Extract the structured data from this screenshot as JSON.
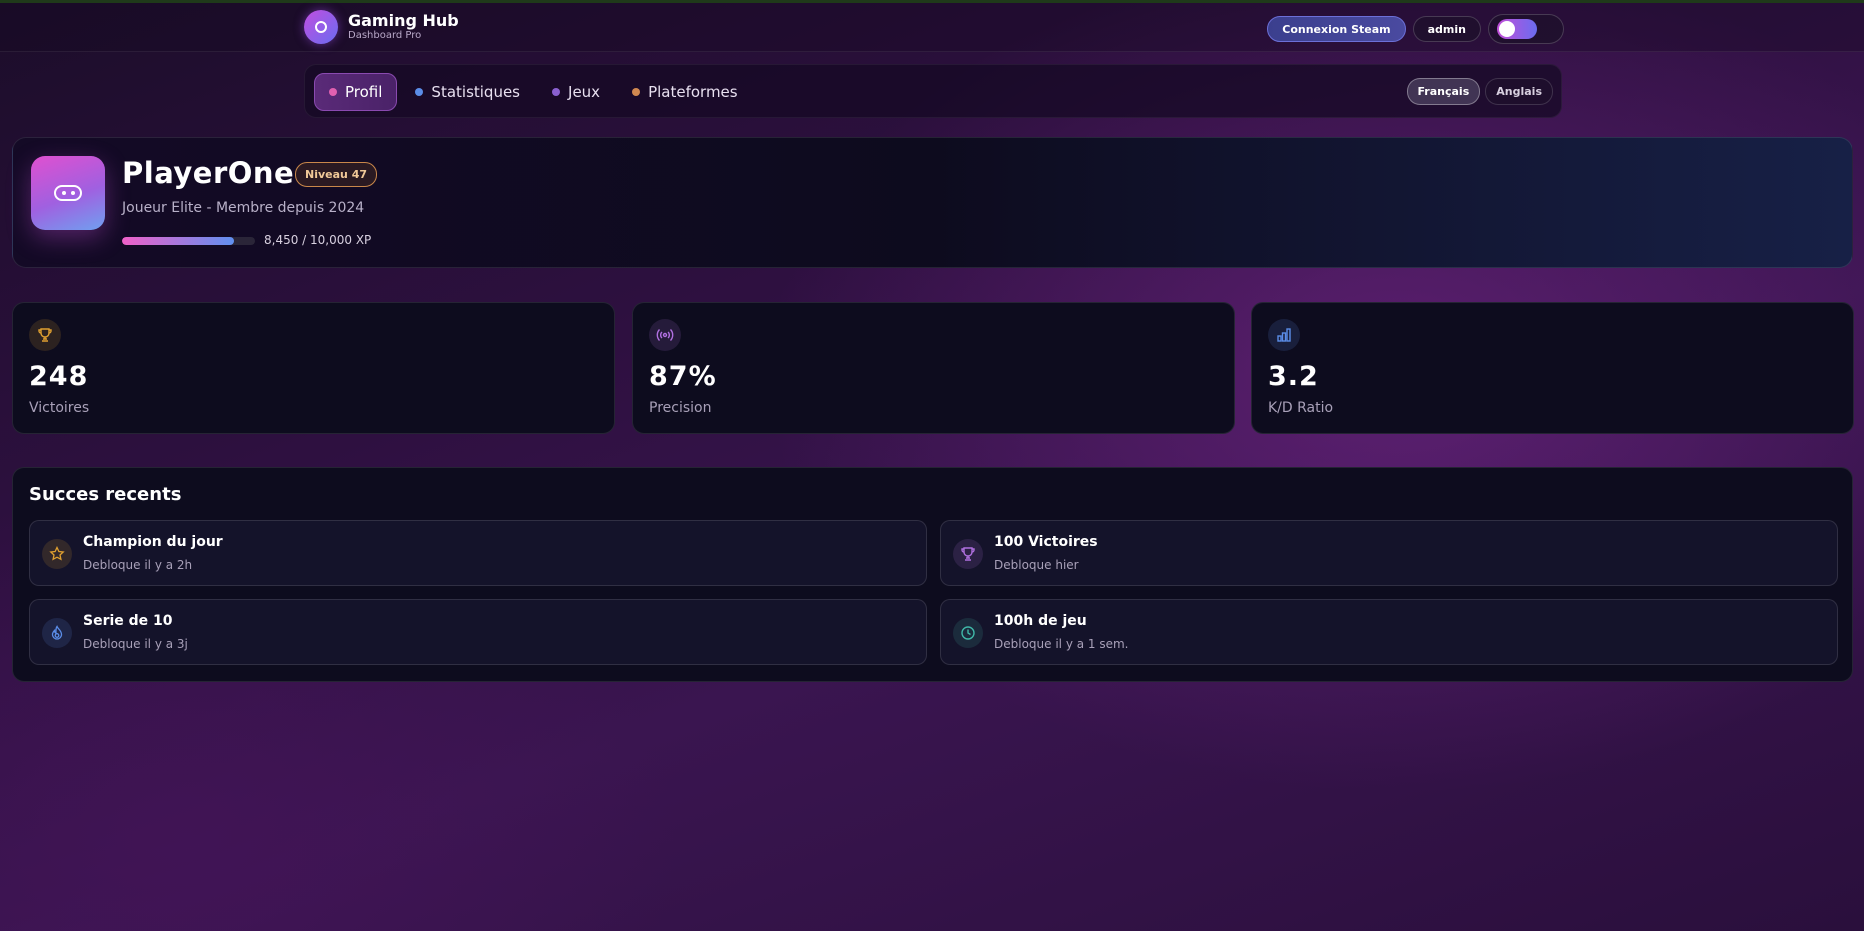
{
  "header": {
    "brand_title": "Gaming Hub",
    "brand_sub": "Dashboard Pro",
    "steam_label": "Connexion Steam",
    "admin_label": "admin"
  },
  "nav": {
    "items": [
      {
        "label": "Profil",
        "dot_color": "#e060b0",
        "active": true
      },
      {
        "label": "Statistiques",
        "dot_color": "#5b8de8",
        "active": false
      },
      {
        "label": "Jeux",
        "dot_color": "#8a60d0",
        "active": false
      },
      {
        "label": "Plateformes",
        "dot_color": "#d08850",
        "active": false
      }
    ],
    "languages": [
      {
        "label": "Français",
        "active": true
      },
      {
        "label": "Anglais",
        "active": false
      }
    ]
  },
  "profile": {
    "name": "PlayerOne",
    "level": "Niveau 47",
    "subtitle": "Joueur Elite - Membre depuis 2024",
    "xp_text": "8,450 / 10,000 XP",
    "xp_progress": 0.845
  },
  "stats": [
    {
      "value": "248",
      "label": "Victoires",
      "icon": "trophy-icon",
      "color": "#e0a030"
    },
    {
      "value": "87%",
      "label": "Precision",
      "icon": "signal-icon",
      "color": "#b070e0"
    },
    {
      "value": "3.2",
      "label": "K/D Ratio",
      "icon": "bar-chart-icon",
      "color": "#5b8de8"
    }
  ],
  "achievements": {
    "title": "Succes recents",
    "items": [
      {
        "name": "Champion du jour",
        "time": "Debloque il y a 2h",
        "icon": "star-icon",
        "color": "#e0a030"
      },
      {
        "name": "100 Victoires",
        "time": "Debloque hier",
        "icon": "trophy-icon",
        "color": "#b070e0"
      },
      {
        "name": "Serie de 10",
        "time": "Debloque il y a 3j",
        "icon": "flame-icon",
        "color": "#5b8de8"
      },
      {
        "name": "100h de jeu",
        "time": "Debloque il y a 1 sem.",
        "icon": "clock-icon",
        "color": "#40b8a8"
      }
    ]
  },
  "colors": {
    "accent_pink": "#e060c8",
    "accent_blue": "#6090f0",
    "card_bg": "#0d0c1e"
  }
}
